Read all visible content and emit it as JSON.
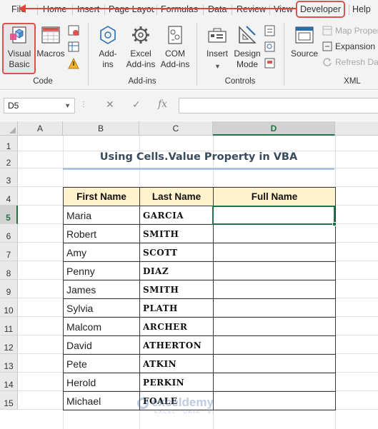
{
  "ribbon_tabs": [
    "File",
    "Home",
    "Insert",
    "Page Layout",
    "Formulas",
    "Data",
    "Review",
    "View",
    "Developer",
    "Help"
  ],
  "ribbon": {
    "code": {
      "label": "Code",
      "visual_basic": [
        "Visual",
        "Basic"
      ],
      "macros": "Macros"
    },
    "addins": {
      "label": "Add-ins",
      "addins": [
        "Add-",
        "ins"
      ],
      "excel_addins": [
        "Excel",
        "Add-ins"
      ],
      "com_addins": [
        "COM",
        "Add-ins"
      ]
    },
    "controls": {
      "label": "Controls",
      "insert": "Insert",
      "design_mode": [
        "Design",
        "Mode"
      ]
    },
    "xml": {
      "label": "XML",
      "source": "Source",
      "map_properties": "Map Properties",
      "expansion_packs": "Expansion Packs",
      "refresh_data": "Refresh Data"
    }
  },
  "formula_bar": {
    "name_box": "D5",
    "cancel_icon": "✕",
    "enter_icon": "✓",
    "fx_icon": "fx",
    "formula": ""
  },
  "columns": [
    "A",
    "B",
    "C",
    "D"
  ],
  "rows": [
    "1",
    "2",
    "3",
    "4",
    "5",
    "6",
    "7",
    "8",
    "9",
    "10",
    "11",
    "12",
    "13",
    "14",
    "15"
  ],
  "selected_cell": "D5",
  "sheet": {
    "title": "Using Cells.Value Property in VBA",
    "headers": [
      "First Name",
      "Last Name",
      "Full Name"
    ],
    "records": [
      {
        "first": "Maria",
        "last": "GARCIA",
        "full": ""
      },
      {
        "first": "Robert",
        "last": "SMITH",
        "full": ""
      },
      {
        "first": "Amy",
        "last": "SCOTT",
        "full": ""
      },
      {
        "first": "Penny",
        "last": "DIAZ",
        "full": ""
      },
      {
        "first": "James",
        "last": "SMITH",
        "full": ""
      },
      {
        "first": "Sylvia",
        "last": "PLATH",
        "full": ""
      },
      {
        "first": "Malcom",
        "last": "ARCHER",
        "full": ""
      },
      {
        "first": "David",
        "last": "ATHERTON",
        "full": ""
      },
      {
        "first": "Pete",
        "last": "ATKIN",
        "full": ""
      },
      {
        "first": "Herold",
        "last": "PERKIN",
        "full": ""
      },
      {
        "first": "Michael",
        "last": "FOALE",
        "full": ""
      }
    ]
  },
  "watermark": {
    "name": "exceldemy",
    "tagline": "EXCEL · DATA · BI"
  },
  "colors": {
    "accent_green": "#217346",
    "highlight_red": "#d9534f",
    "header_fill": "#fff2cc",
    "title_rule": "#a8c4e0"
  }
}
